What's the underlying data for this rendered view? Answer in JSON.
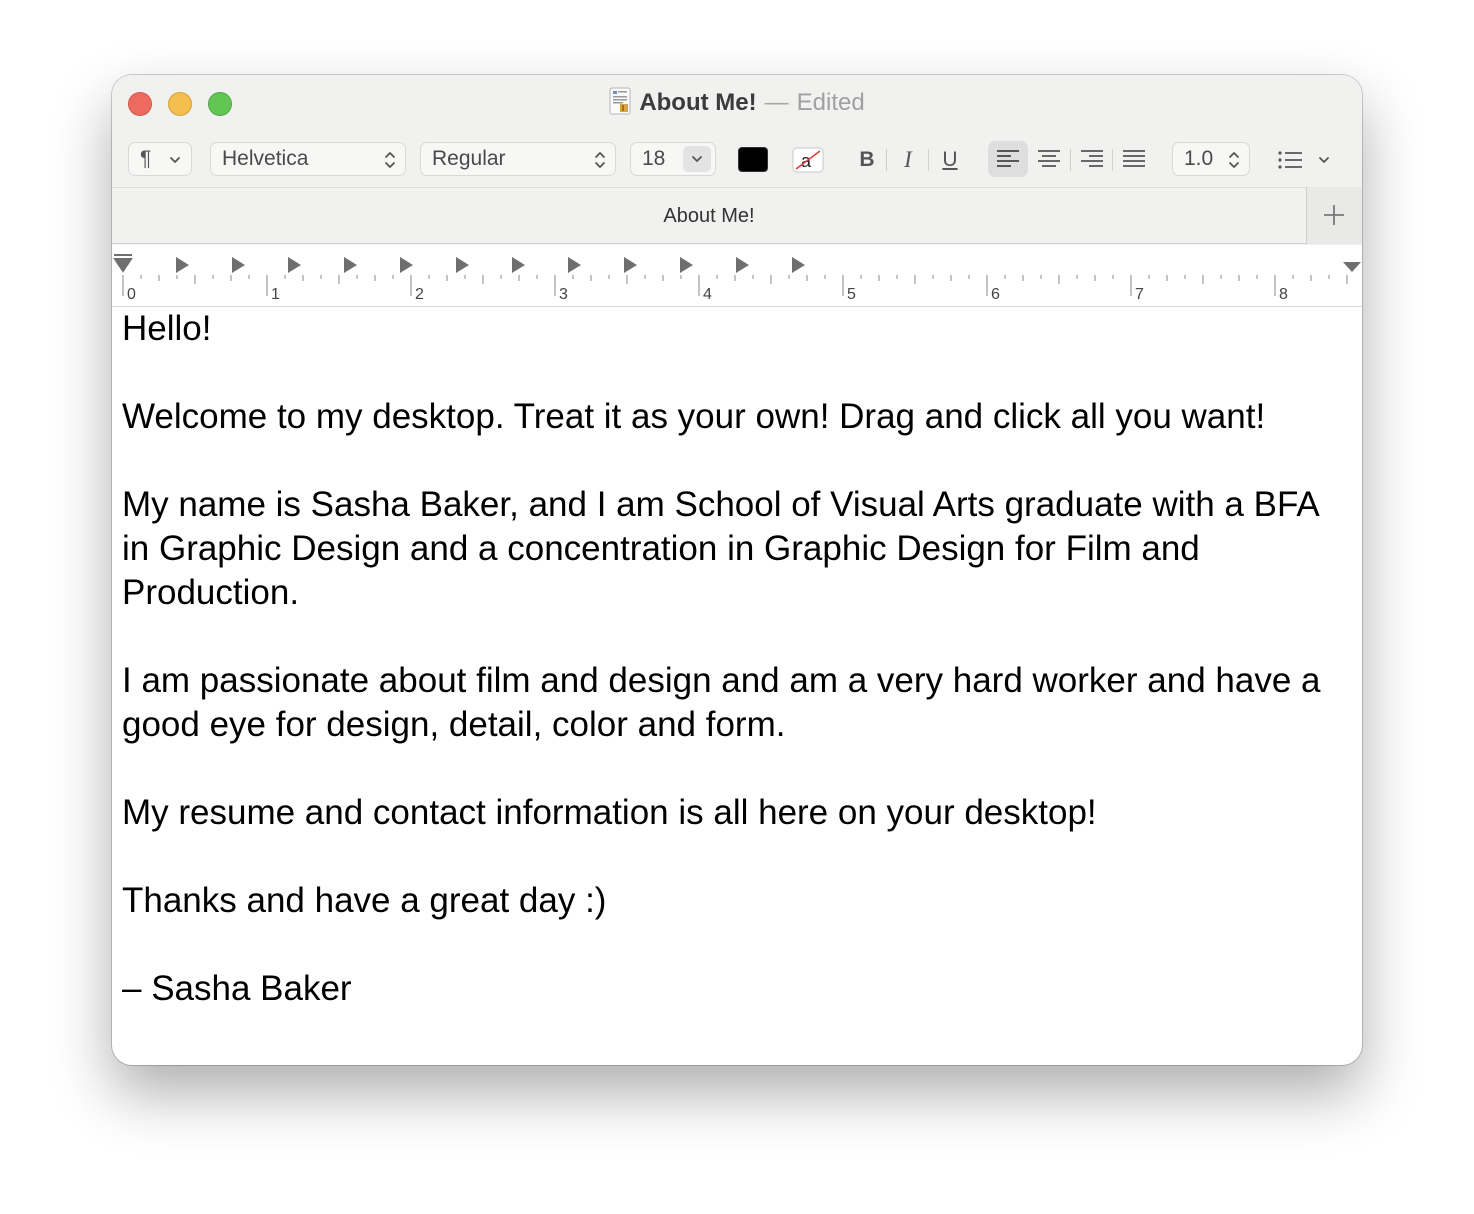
{
  "window": {
    "title": "About Me!",
    "title_separator": "—",
    "status": "Edited"
  },
  "toolbar": {
    "paragraph_style": "¶",
    "font_family": "Helvetica",
    "font_typeface": "Regular",
    "font_size": "18",
    "text_color": "#000000",
    "bold_label": "B",
    "italic_label": "I",
    "underline_label": "U",
    "line_spacing": "1.0"
  },
  "tab": {
    "label": "About Me!"
  },
  "ruler": {
    "labels": [
      "0",
      "1",
      "2",
      "3",
      "4",
      "5",
      "6",
      "7",
      "8"
    ]
  },
  "document": {
    "paragraphs": [
      "Hello!",
      "",
      "Welcome to my desktop. Treat it as your own! Drag and click all you want!",
      "",
      "My name is Sasha Baker, and I am School of Visual Arts graduate with a BFA in Graphic Design and a concentration in Graphic Design for Film and Production.",
      "",
      "I am passionate about film and design and am a very hard worker and have a good eye for design, detail, color and form.",
      "",
      "My resume and contact information is all here on your desktop!",
      "",
      "Thanks and have a great day :)",
      "",
      "– Sasha Baker"
    ]
  }
}
